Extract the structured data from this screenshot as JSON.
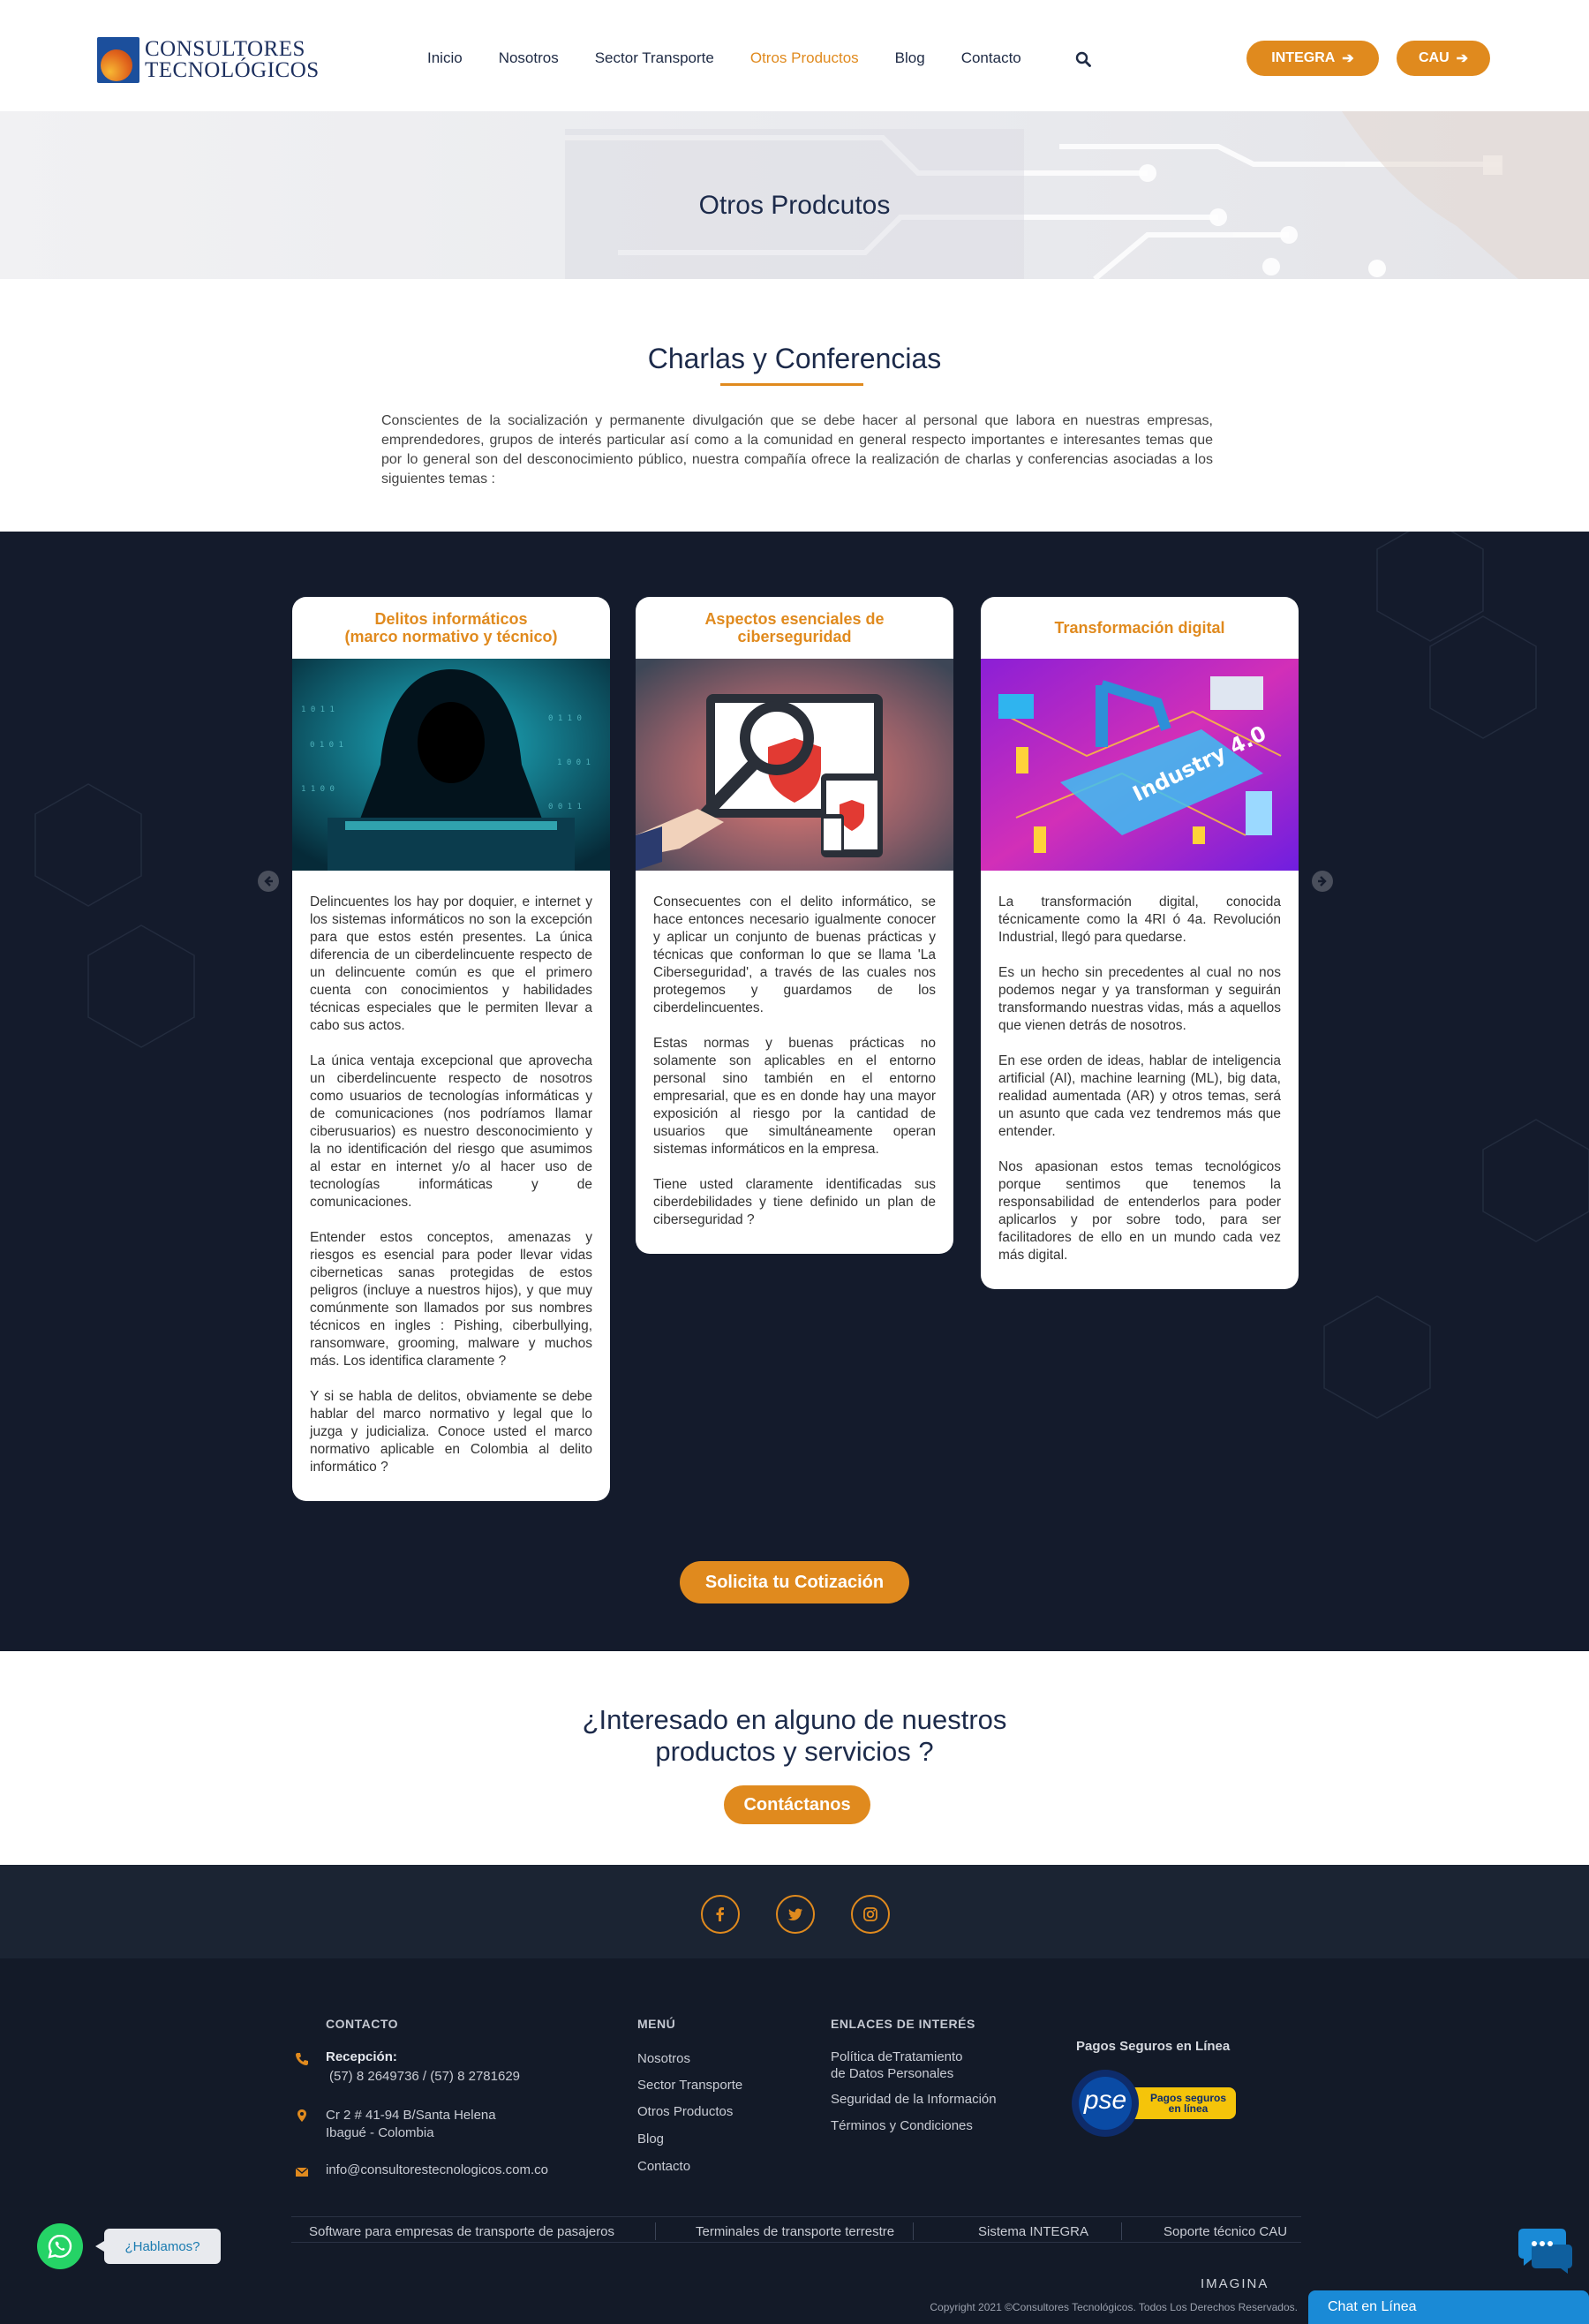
{
  "brand": {
    "line1": "CONSULTORES",
    "line2": "TECNOLÓGICOS",
    "accent": "#e08a1e",
    "navy": "#141b2c"
  },
  "nav": {
    "items": [
      {
        "label": "Inicio"
      },
      {
        "label": "Nosotros"
      },
      {
        "label": "Sector Transporte"
      },
      {
        "label": "Otros Productos",
        "active": true
      },
      {
        "label": "Blog"
      },
      {
        "label": "Contacto"
      }
    ],
    "integra_label": "INTEGRA",
    "cau_label": "CAU"
  },
  "hero": {
    "title": "Otros Prodcutos"
  },
  "intro": {
    "title": "Charlas y Conferencias",
    "text": "Conscientes de la socialización y permanente divulgación que se debe hacer al personal que labora en nuestras empresas, emprendedores, grupos de interés particular así como a la comunidad en general respecto importantes e interesantes temas que por lo general son del desconocimiento público, nuestra compañía ofrece la realización de charlas y conferencias asociadas a los siguientes temas :"
  },
  "cards": [
    {
      "title_line1": "Delitos informáticos",
      "title_line2": "(marco normativo y técnico)",
      "paragraphs": [
        "Delincuentes los hay por doquier, e internet y los sistemas informáticos no son la excepción para que estos estén presentes. La única diferencia de un ciberdelincuente respecto de un delincuente común es que el primero cuenta con conocimientos y habilidades técnicas especiales que le permiten llevar a cabo sus actos.",
        "La única ventaja excepcional que aprovecha un ciberdelincuente respecto de nosotros como usuarios de tecnologías informáticas y de comunicaciones (nos podríamos llamar ciberusuarios) es nuestro desconocimiento y la no identificación del riesgo que asumimos al estar en internet y/o al hacer uso de tecnologías informáticas y de comunicaciones.",
        "Entender estos conceptos, amenazas y riesgos es esencial para poder llevar vidas ciberneticas sanas protegidas de estos peligros (incluye a nuestros hijos), y que muy comúnmente son llamados por sus nombres técnicos en ingles : Pishing, ciberbullying, ransomware, grooming, malware y muchos más. Los identifica claramente ?",
        "Y si se habla de delitos, obviamente se debe hablar del marco normativo y legal que lo juzga y judicializa. Conoce usted el marco normativo aplicable en Colombia al delito informático ?"
      ]
    },
    {
      "title_line1": "Aspectos esenciales de",
      "title_line2": "ciberseguridad",
      "paragraphs": [
        "Consecuentes con el delito informático, se hace entonces necesario igualmente conocer y aplicar un conjunto de buenas prácticas y técnicas que conforman lo que se llama 'La Ciberseguridad', a través de las cuales nos protegemos y guardamos de los ciberdelincuentes.",
        "Estas normas y buenas prácticas no solamente son aplicables en el entorno personal sino también en el entorno empresarial, que es en donde hay una mayor exposición al riesgo por la cantidad de usuarios que simultáneamente operan sistemas informáticos en la empresa.",
        "Tiene usted claramente identificadas sus ciberdebilidades y tiene definido un plan de ciberseguridad ?"
      ]
    },
    {
      "title_line1": "Transformación digital",
      "title_line2": "",
      "image_text": "Industry 4.0",
      "paragraphs": [
        "La transformación digital, conocida técnicamente como la 4RI ó 4a. Revolución Industrial, llegó para quedarse.",
        "Es un hecho sin precedentes al cual no nos podemos negar y ya transforman y seguirán transformando nuestras vidas, más a aquellos que vienen detrás de nosotros.",
        "En ese orden de ideas, hablar de inteligencia artificial (AI), machine learning (ML), big data, realidad aumentada (AR) y otros temas, será un asunto que cada vez tendremos más que entender.",
        "Nos apasionan estos temas tecnológicos porque sentimos que tenemos la responsabilidad de entenderlos para poder aplicarlos y por sobre todo, para ser facilitadores de ello en un mundo cada vez más digital."
      ]
    }
  ],
  "quote_button": "Solicita tu Cotización",
  "cta": {
    "line1": "¿Interesado en alguno de nuestros",
    "line2": "productos y servicios ?",
    "button": "Contáctanos"
  },
  "footer": {
    "social": [
      "facebook-icon",
      "twitter-icon",
      "instagram-icon"
    ],
    "contact_head": "CONTACTO",
    "reception_label": "Recepción:",
    "phones": "(57) 8 2649736 / (57) 8 2781629",
    "address_line1": "Cr 2 # 41-94 B/Santa Helena",
    "address_line2": "Ibagué - Colombia",
    "email": "info@consultorestecnologicos.com.co",
    "menu_head": "MENÚ",
    "menu": [
      "Nosotros",
      "Sector Transporte",
      "Otros Productos",
      "Blog",
      "Contacto"
    ],
    "links_head": "ENLACES DE INTERÉS",
    "links": [
      {
        "line1": "Política deTratamiento",
        "line2": "de Datos Personales"
      },
      {
        "line1": "Seguridad de la Información",
        "line2": ""
      },
      {
        "line1": "Términos y Condiciones",
        "line2": ""
      }
    ],
    "pse_head": "Pagos Seguros en Línea",
    "pse_logo": "pse",
    "pse_tag1": "Pagos seguros",
    "pse_tag2": "en línea",
    "bottom_links": [
      "Software para empresas de transporte de pasajeros",
      "Terminales de transporte terrestre",
      "Sistema INTEGRA",
      "Soporte técnico CAU"
    ],
    "imagina": "IMAGINA",
    "copyright": "Copyright 2021 ©Consultores Tecnológicos. Todos Los Derechos Reservados."
  },
  "whatsapp_bubble": "¿Hablamos?",
  "chat_bar": "Chat en Línea"
}
